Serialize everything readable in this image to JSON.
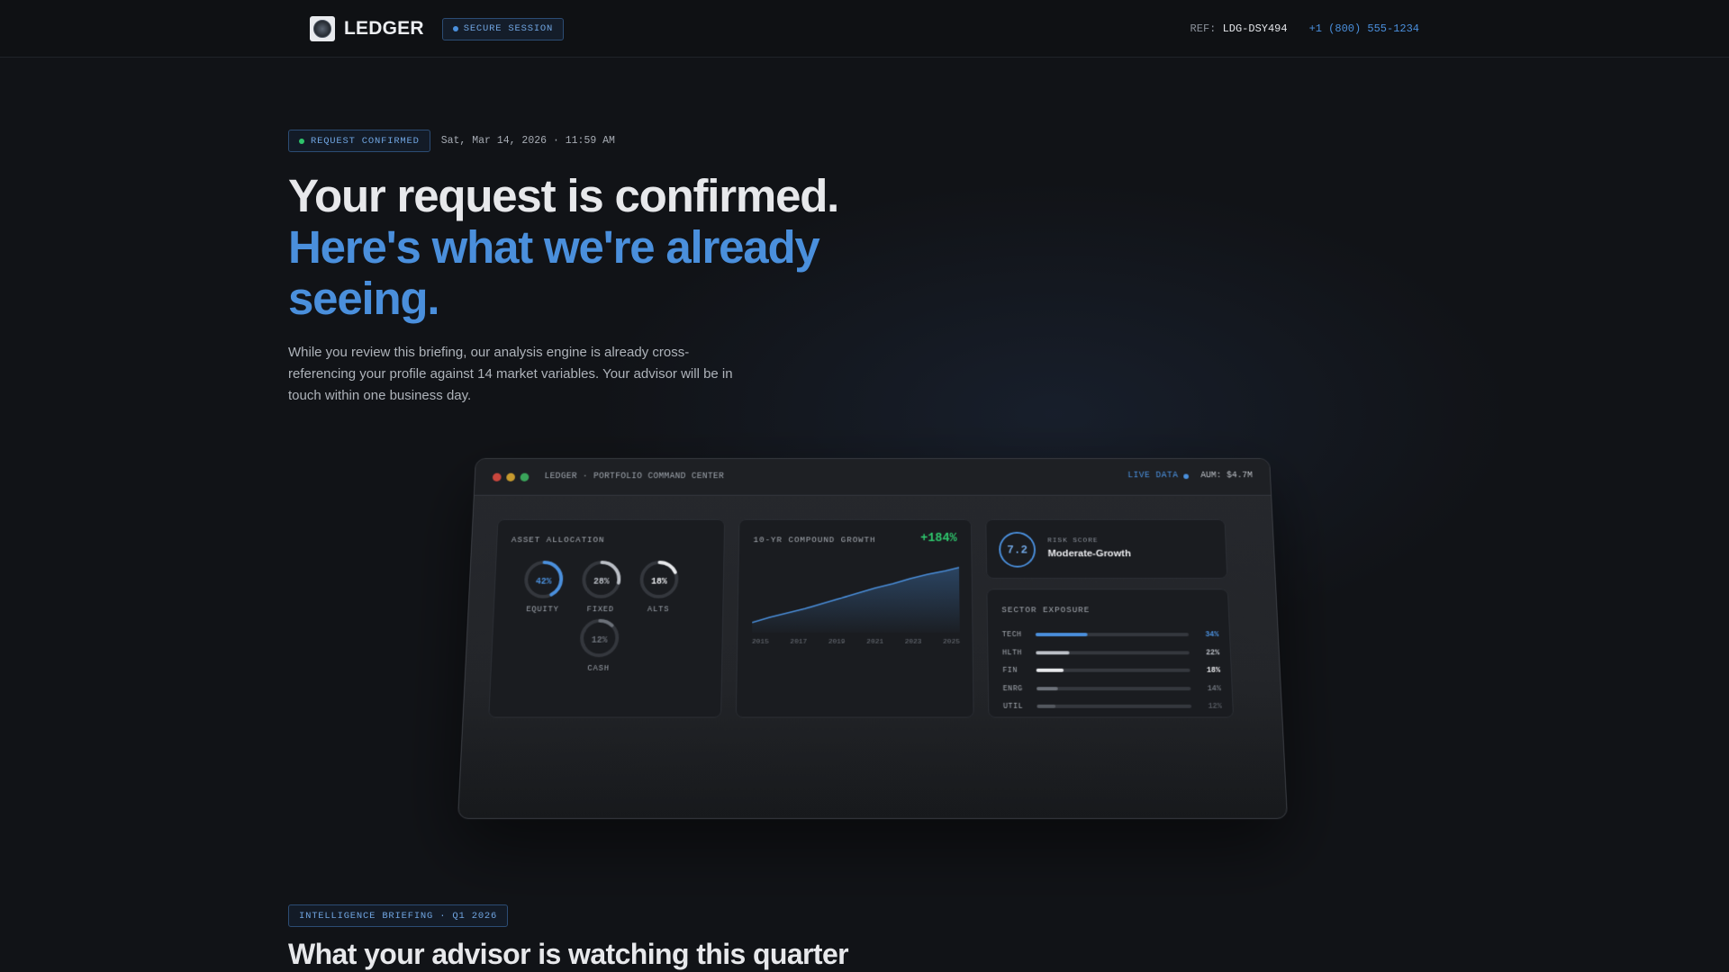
{
  "header": {
    "brand": "LEDGER",
    "secure_badge": "SECURE SESSION",
    "ref_label": "REF:",
    "ref_value": "LDG-DSY494",
    "phone": "+1 (800) 555-1234"
  },
  "hero": {
    "status_badge": "REQUEST CONFIRMED",
    "timestamp": "Sat, Mar 14, 2026 · 11:59 AM",
    "headline_line1": "Your request is confirmed.",
    "headline_line2": "Here's what we're already seeing.",
    "lede": "While you review this briefing, our analysis engine is already cross-referencing your profile against 14 market variables. Your advisor will be in touch within one business day."
  },
  "dashboard": {
    "title": "LEDGER · PORTFOLIO COMMAND CENTER",
    "live_label": "LIVE DATA",
    "aum": "AUM: $4.7M",
    "allocation": {
      "title": "ASSET ALLOCATION",
      "items": [
        {
          "label": "EQUITY",
          "value": 42,
          "display": "42%",
          "color": "#4a8fdc"
        },
        {
          "label": "FIXED",
          "value": 28,
          "display": "28%",
          "color": "#b9bdc4"
        },
        {
          "label": "ALTS",
          "value": 18,
          "display": "18%",
          "color": "#e6e7ea"
        },
        {
          "label": "CASH",
          "value": 12,
          "display": "12%",
          "color": "#6b7078"
        }
      ]
    },
    "growth": {
      "title": "10-YR COMPOUND GROWTH",
      "change": "+184%",
      "years": [
        "2015",
        "2017",
        "2019",
        "2021",
        "2023",
        "2025"
      ]
    },
    "risk": {
      "score": "7.2",
      "label": "RISK SCORE",
      "value": "Moderate-Growth"
    },
    "sectors": {
      "title": "SECTOR EXPOSURE",
      "items": [
        {
          "code": "TECH",
          "value": 34,
          "display": "34%",
          "color": "#4a8fdc"
        },
        {
          "code": "HLTH",
          "value": 22,
          "display": "22%",
          "color": "#b9bdc4"
        },
        {
          "code": "FIN",
          "value": 18,
          "display": "18%",
          "color": "#e6e7ea"
        },
        {
          "code": "ENRG",
          "value": 14,
          "display": "14%",
          "color": "#6b7078"
        },
        {
          "code": "UTIL",
          "value": 12,
          "display": "12%",
          "color": "#53575e"
        }
      ]
    }
  },
  "briefing": {
    "badge": "INTELLIGENCE BRIEFING · Q1 2026",
    "title": "What your advisor is watching this quarter"
  },
  "colors": {
    "accent": "#4a8fdc",
    "positive": "#2ec46b",
    "background": "#111317"
  }
}
